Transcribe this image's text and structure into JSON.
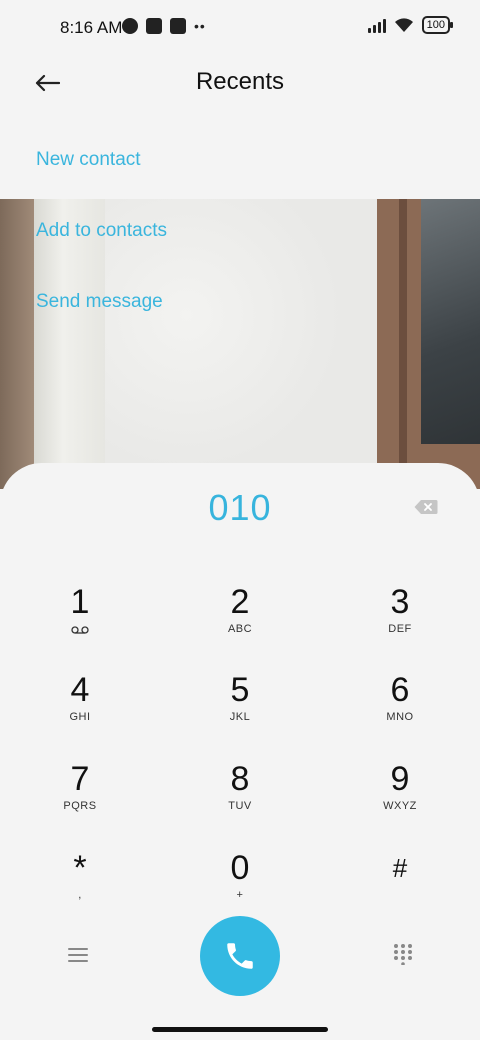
{
  "status_bar": {
    "time": "8:16 AM",
    "battery": "100"
  },
  "header": {
    "title": "Recents"
  },
  "menu": {
    "new_contact": "New contact",
    "add_to_contacts": "Add to contacts",
    "send_message": "Send message"
  },
  "dialer": {
    "number": "010",
    "keys": [
      {
        "digit": "1",
        "letters": ""
      },
      {
        "digit": "2",
        "letters": "ABC"
      },
      {
        "digit": "3",
        "letters": "DEF"
      },
      {
        "digit": "4",
        "letters": "GHI"
      },
      {
        "digit": "5",
        "letters": "JKL"
      },
      {
        "digit": "6",
        "letters": "MNO"
      },
      {
        "digit": "7",
        "letters": "PQRS"
      },
      {
        "digit": "8",
        "letters": "TUV"
      },
      {
        "digit": "9",
        "letters": "WXYZ"
      },
      {
        "digit": "*",
        "letters": ","
      },
      {
        "digit": "0",
        "letters": "+"
      },
      {
        "digit": "#",
        "letters": ""
      }
    ]
  },
  "colors": {
    "accent": "#33b9e2",
    "text": "#111111",
    "background": "#f4f4f4"
  },
  "icons": [
    "back-arrow-icon",
    "backspace-icon",
    "voicemail-icon",
    "phone-icon",
    "menu-icon",
    "dialpad-icon"
  ]
}
